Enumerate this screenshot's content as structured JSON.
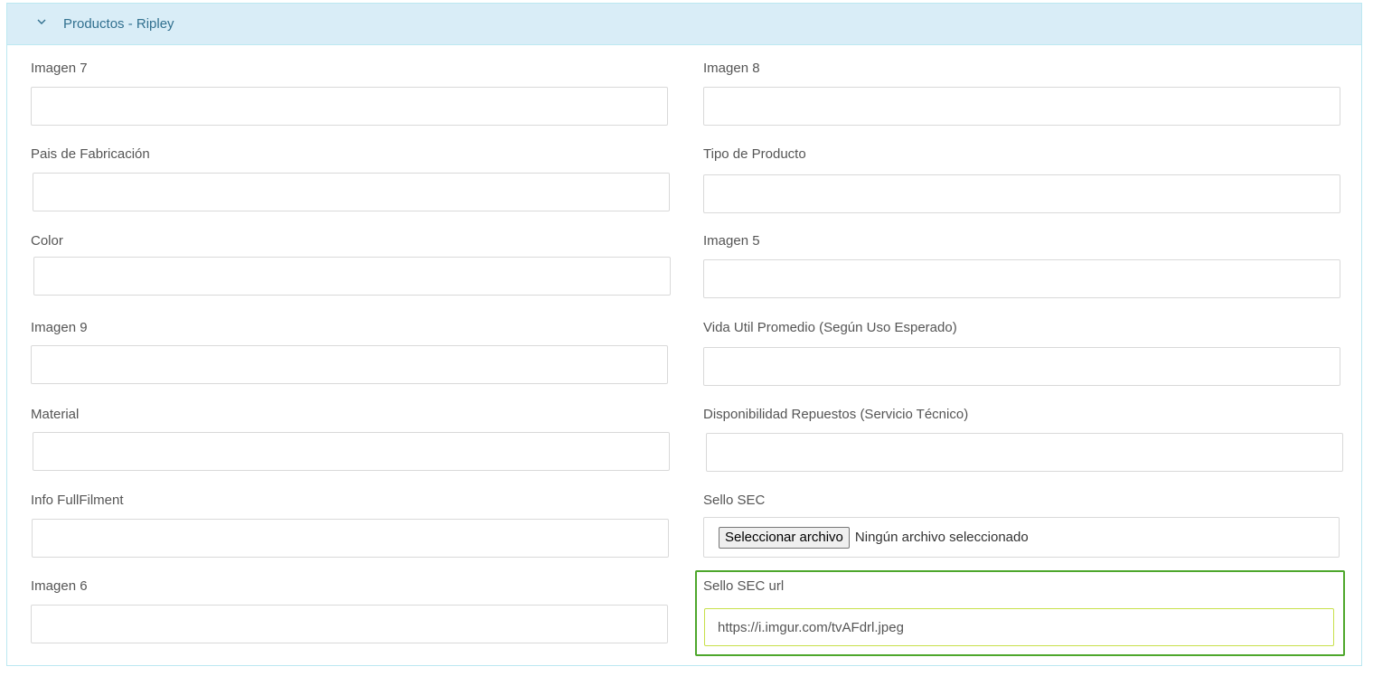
{
  "panel": {
    "title": "Productos - Ripley",
    "toggle_icon": "chevron-down-icon"
  },
  "fields": {
    "imagen7": {
      "label": "Imagen 7",
      "value": ""
    },
    "imagen8": {
      "label": "Imagen 8",
      "value": ""
    },
    "pais_fabricacion": {
      "label": "Pais de Fabricación",
      "value": ""
    },
    "tipo_producto": {
      "label": "Tipo de Producto",
      "value": ""
    },
    "color": {
      "label": "Color",
      "value": ""
    },
    "imagen5": {
      "label": "Imagen 5",
      "value": ""
    },
    "imagen9": {
      "label": "Imagen 9",
      "value": ""
    },
    "vida_util": {
      "label": "Vida Util Promedio (Según Uso Esperado)",
      "value": ""
    },
    "material": {
      "label": "Material",
      "value": ""
    },
    "disponibilidad_repuestos": {
      "label": "Disponibilidad Repuestos (Servicio Técnico)",
      "value": ""
    },
    "info_fullfilment": {
      "label": "Info FullFilment",
      "value": ""
    },
    "sello_sec": {
      "label": "Sello SEC",
      "button_label": "Seleccionar archivo",
      "status": "Ningún archivo seleccionado"
    },
    "imagen6": {
      "label": "Imagen 6",
      "value": ""
    },
    "sello_sec_url": {
      "label": "Sello SEC url",
      "value": "https://i.imgur.com/tvAFdrl.jpeg"
    }
  },
  "colors": {
    "heading_bg": "#d9edf7",
    "heading_text": "#31708f",
    "highlight_border": "#4ea72c",
    "highlight_input_border": "#c8e04a"
  }
}
